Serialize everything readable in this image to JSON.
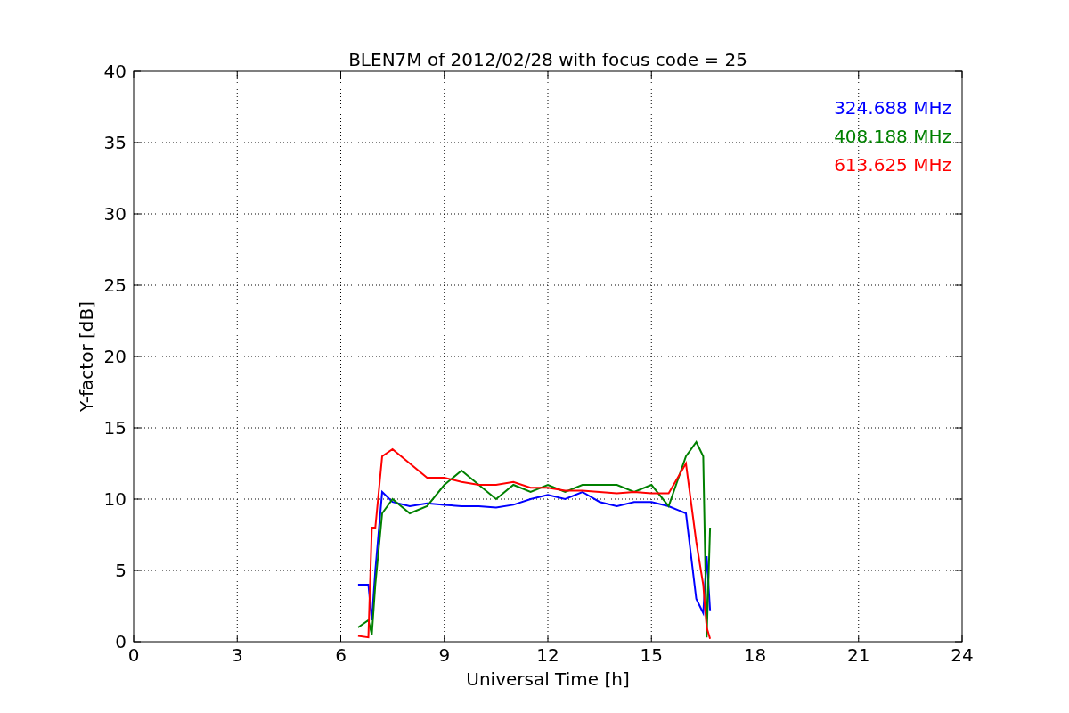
{
  "chart_data": {
    "type": "line",
    "title": "BLEN7M of 2012/02/28 with focus code = 25",
    "xlabel": "Universal Time [h]",
    "ylabel": "Y-factor [dB]",
    "x": [
      6.5,
      6.8,
      6.9,
      7.0,
      7.2,
      7.5,
      8,
      8.5,
      9,
      9.5,
      10,
      10.5,
      11,
      11.5,
      12,
      12.5,
      13,
      13.5,
      14,
      14.5,
      15,
      15.5,
      16,
      16.3,
      16.5,
      16.6,
      16.7
    ],
    "series": [
      {
        "name": "324.688 MHz",
        "color": "#0000ff",
        "values": [
          4,
          4,
          1.5,
          5,
          10.5,
          9.8,
          9.5,
          9.7,
          9.6,
          9.5,
          9.5,
          9.4,
          9.6,
          10,
          10.3,
          10,
          10.5,
          9.8,
          9.5,
          9.8,
          9.8,
          9.5,
          9,
          3,
          2,
          6,
          2.2
        ]
      },
      {
        "name": "408.188 MHz",
        "color": "#008000",
        "values": [
          1,
          1.5,
          0.5,
          4,
          9,
          10,
          9,
          9.5,
          11,
          12,
          11,
          10,
          11,
          10.5,
          11,
          10.5,
          11,
          11,
          11,
          10.5,
          11,
          9.5,
          13,
          14,
          13,
          0.3,
          8
        ]
      },
      {
        "name": "613.625 MHz",
        "color": "#ff0000",
        "values": [
          0.4,
          0.3,
          8,
          8,
          13,
          13.5,
          12.5,
          11.5,
          11.5,
          11.2,
          11,
          11,
          11.2,
          10.8,
          10.8,
          10.6,
          10.6,
          10.5,
          10.4,
          10.5,
          10.4,
          10.4,
          12.5,
          7,
          4,
          1,
          0.2
        ]
      }
    ],
    "xlim": [
      0,
      24
    ],
    "ylim": [
      0,
      40
    ],
    "xticks": [
      0,
      3,
      6,
      9,
      12,
      15,
      18,
      21,
      24
    ],
    "yticks": [
      0,
      5,
      10,
      15,
      20,
      25,
      30,
      35,
      40
    ],
    "grid": true
  }
}
